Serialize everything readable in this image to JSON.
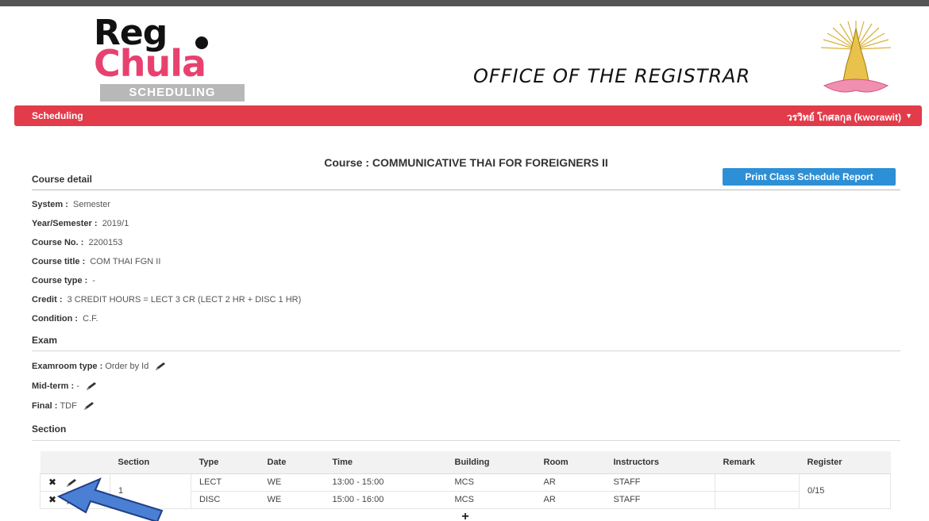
{
  "header": {
    "logo_reg": "Reg",
    "logo_chula": "Chula",
    "logo_scheduling": "SCHEDULING",
    "office_title": "OFFICE OF THE REGISTRAR",
    "emblem_icon": "chula-emblem-icon"
  },
  "nav": {
    "left": "Scheduling",
    "user": "วรวิทย์ โกศลกุล (kworawit)",
    "bg_color": "#e23b4a"
  },
  "course": {
    "heading": "Course : COMMUNICATIVE THAI FOR FOREIGNERS II",
    "detail_title": "Course detail",
    "print_button": "Print Class Schedule Report",
    "fields": [
      {
        "label": "System :",
        "value": "Semester"
      },
      {
        "label": "Year/Semester :",
        "value": "2019/1"
      },
      {
        "label": "Course No. :",
        "value": "2200153"
      },
      {
        "label": "Course title :",
        "value": "COM THAI FGN II"
      },
      {
        "label": "Course type :",
        "value": "-"
      },
      {
        "label": "Credit :",
        "value": "3 CREDIT HOURS = LECT 3 CR (LECT 2 HR + DISC 1 HR)"
      },
      {
        "label": "Condition :",
        "value": "C.F."
      }
    ]
  },
  "exam": {
    "title": "Exam",
    "fields": [
      {
        "label": "Examroom type :",
        "value": "Order by Id"
      },
      {
        "label": "Mid-term :",
        "value": "-"
      },
      {
        "label": "Final :",
        "value": "TDF"
      }
    ]
  },
  "section": {
    "title": "Section",
    "columns": [
      "Section",
      "Type",
      "Date",
      "Time",
      "Building",
      "Room",
      "Instructors",
      "Remark",
      "Register"
    ],
    "section_no": "1",
    "register": "0/15",
    "rows": [
      {
        "type": "LECT",
        "date": "WE",
        "time": "13:00 - 15:00",
        "building": "MCS",
        "room": "AR",
        "instructors": "STAFF",
        "remark": ""
      },
      {
        "type": "DISC",
        "date": "WE",
        "time": "15:00 - 16:00",
        "building": "MCS",
        "room": "AR",
        "instructors": "STAFF",
        "remark": ""
      }
    ],
    "delete_glyph": "✖",
    "add_glyph": "+"
  }
}
